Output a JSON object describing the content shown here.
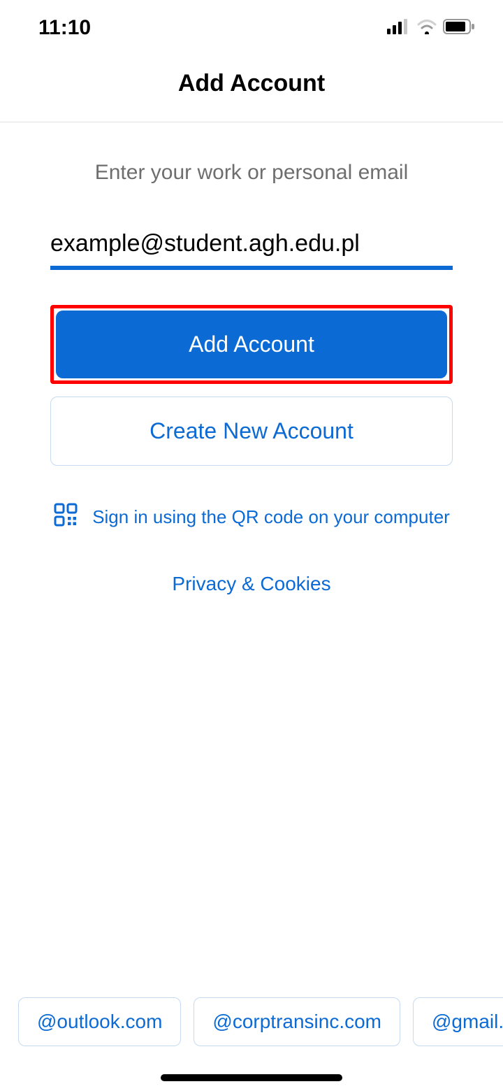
{
  "status": {
    "time": "11:10"
  },
  "header": {
    "title": "Add Account"
  },
  "main": {
    "subtitle": "Enter your work or personal email",
    "email_value": "example@student.agh.edu.pl",
    "add_account_label": "Add Account",
    "create_account_label": "Create New Account",
    "qr_signin_label": "Sign in using the QR code on your computer",
    "privacy_label": "Privacy & Cookies"
  },
  "suggestions": [
    "@outlook.com",
    "@corptransinc.com",
    "@gmail.c"
  ]
}
